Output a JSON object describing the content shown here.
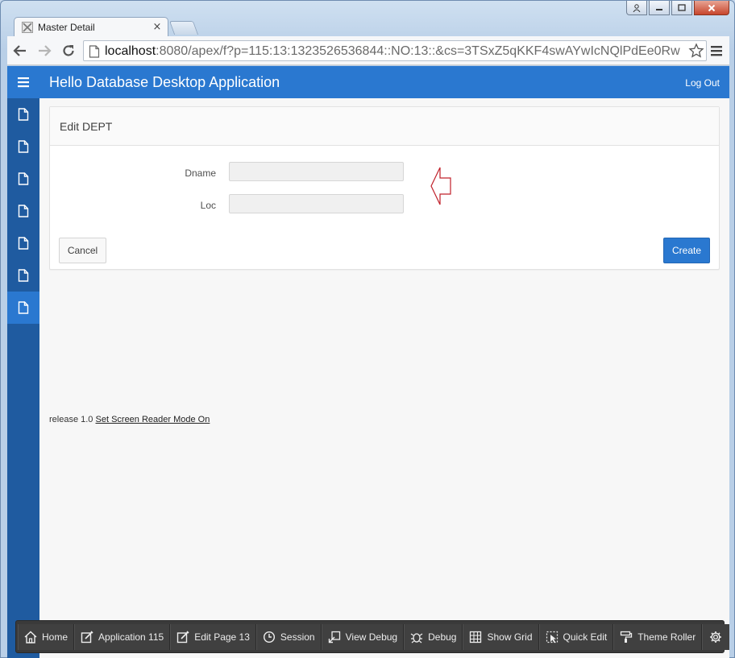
{
  "browser": {
    "tab_title": "Master Detail",
    "url_host": "localhost",
    "url_rest": ":8080/apex/f?p=115:13:1323526536844::NO:13::&cs=3TSxZ5qKKF4swAYwIcNQlPdEe0Rw"
  },
  "app": {
    "title": "Hello Database Desktop Application",
    "logout_label": "Log Out",
    "sidebar_items": [
      "page-icon",
      "page-icon",
      "page-icon",
      "page-icon",
      "page-icon",
      "page-icon",
      "page-icon"
    ],
    "active_sidebar_index": 6
  },
  "form": {
    "region_title": "Edit DEPT",
    "dname_label": "Dname",
    "dname_value": "",
    "loc_label": "Loc",
    "loc_value": "",
    "cancel_label": "Cancel",
    "create_label": "Create"
  },
  "footer": {
    "release": "release 1.0",
    "screen_reader_link": "Set Screen Reader Mode On"
  },
  "dev_toolbar": {
    "home": "Home",
    "application": "Application 115",
    "edit_page": "Edit Page 13",
    "session": "Session",
    "view_debug": "View Debug",
    "debug": "Debug",
    "show_grid": "Show Grid",
    "quick_edit": "Quick Edit",
    "theme_roller": "Theme Roller"
  },
  "colors": {
    "header": "#2a78d0",
    "sidebar": "#1f5ba0",
    "primary_button": "#2a78d0",
    "annotation_arrow": "#c0202a"
  }
}
